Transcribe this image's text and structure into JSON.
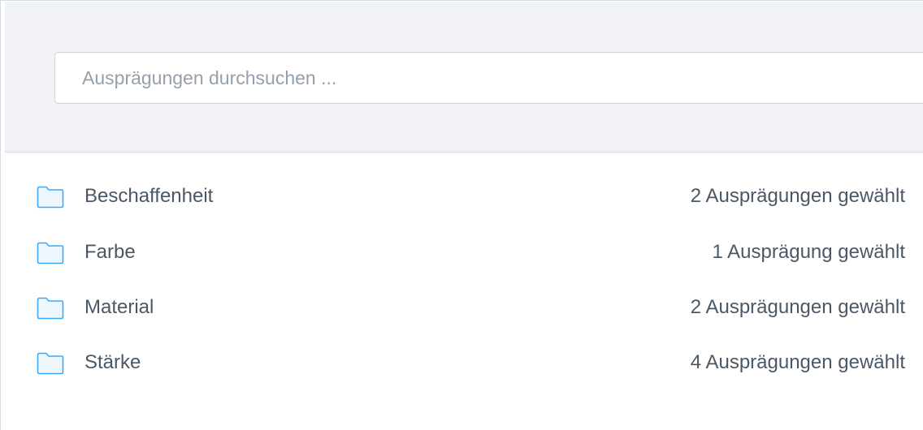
{
  "search": {
    "placeholder": "Ausprägungen durchsuchen ...",
    "value": ""
  },
  "colors": {
    "folder_stroke": "#3fa9f5",
    "folder_fill": "#eef7fd",
    "text": "#4a5866",
    "placeholder": "#94a0ac",
    "header_bg": "#f1f2f5"
  },
  "items": [
    {
      "label": "Beschaffenheit",
      "count": "2 Ausprägungen gewählt",
      "icon": "folder-icon"
    },
    {
      "label": "Farbe",
      "count": "1 Ausprägung gewählt",
      "icon": "folder-icon"
    },
    {
      "label": "Material",
      "count": "2 Ausprägungen gewählt",
      "icon": "folder-icon"
    },
    {
      "label": "Stärke",
      "count": "4 Ausprägungen gewählt",
      "icon": "folder-icon"
    }
  ]
}
